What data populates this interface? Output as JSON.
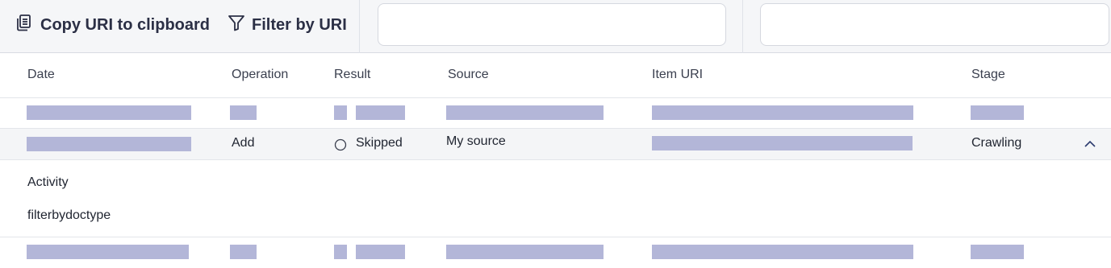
{
  "toolbar": {
    "copy_label": "Copy URI to clipboard",
    "filter_label": "Filter by URI",
    "input1_value": "",
    "input2_value": ""
  },
  "table": {
    "columns": [
      "Date",
      "Operation",
      "Result",
      "Source",
      "Item URI",
      "Stage"
    ],
    "expanded_row": {
      "operation": "Add",
      "result": "Skipped",
      "source": "My source",
      "stage": "Crawling"
    },
    "detail": {
      "line1": "Activity",
      "line2": "filterbydoctype"
    }
  },
  "colors": {
    "redaction": "#b3b6d8",
    "toolbar_bg": "#f5f6f8",
    "selected_row_bg": "#f4f5f7"
  }
}
